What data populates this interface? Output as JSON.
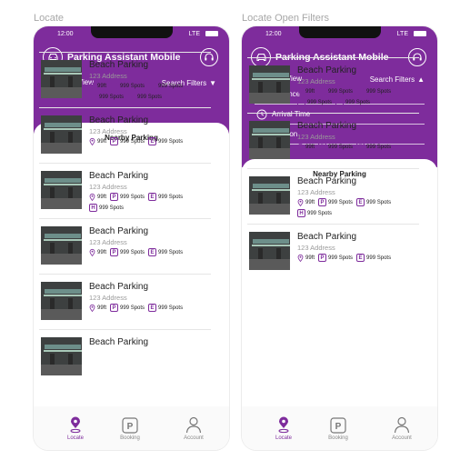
{
  "frames": [
    {
      "label": "Locate",
      "status": {
        "time": "12:00",
        "network": "LTE"
      },
      "app_title": "Parking Assistant Mobile",
      "map_view_label": "Map View",
      "search_filters_label": "Search Filters",
      "search_filters_arrow": "▼",
      "section_title": "Nearby Parking",
      "items": [
        {
          "name": "Beach Parking",
          "address": "123 Address",
          "distance": "99ft",
          "parking_spots": "999 Spots",
          "electric_spots": "999 Spots",
          "handicap_spots": "999 Spots",
          "reserved_spots": "999 Spots"
        },
        {
          "name": "Beach Parking",
          "address": "123 Address",
          "distance": "99ft",
          "parking_spots": "999 Spots",
          "electric_spots": "999 Spots"
        },
        {
          "name": "Beach Parking",
          "address": "123 Address",
          "distance": "99ft",
          "parking_spots": "999 Spots",
          "electric_spots": "999 Spots",
          "handicap_spots": "999 Spots"
        },
        {
          "name": "Beach Parking",
          "address": "123 Address",
          "distance": "99ft",
          "parking_spots": "999 Spots",
          "electric_spots": "999 Spots"
        },
        {
          "name": "Beach Parking",
          "address": "123 Address",
          "distance": "99ft",
          "parking_spots": "999 Spots",
          "electric_spots": "999 Spots"
        },
        {
          "name": "Beach Parking"
        }
      ],
      "tabs": [
        {
          "label": "Locate",
          "icon": "location-pin-icon",
          "active": true
        },
        {
          "label": "Booking",
          "icon": "parking-sign-icon",
          "active": false
        },
        {
          "label": "Account",
          "icon": "user-icon",
          "active": false
        }
      ]
    },
    {
      "label": "Locate Open Filters",
      "status": {
        "time": "12:00",
        "network": "LTE"
      },
      "app_title": "Parking Assistant Mobile",
      "map_view_label": "Map View",
      "search_filters_label": "Search Filters",
      "search_filters_arrow": "▲",
      "filters": [
        {
          "label": "Distance",
          "icon": "distance-icon"
        },
        {
          "label": "Arrival Time",
          "icon": "clock-icon"
        },
        {
          "label": "Location",
          "icon": "location-pin-icon"
        }
      ],
      "section_title": "Nearby Parking",
      "items": [
        {
          "name": "Beach Parking",
          "address": "123 Address",
          "distance": "99ft",
          "parking_spots": "999 Spots",
          "electric_spots": "999 Spots",
          "handicap_spots": "999 Spots",
          "reserved_spots": "999 Spots"
        },
        {
          "name": "Beach Parking",
          "address": "123 Address",
          "distance": "99ft",
          "parking_spots": "999 Spots",
          "electric_spots": "999 Spots"
        },
        {
          "name": "Beach Parking",
          "address": "123 Address",
          "distance": "99ft",
          "parking_spots": "999 Spots",
          "electric_spots": "999 Spots",
          "handicap_spots": "999 Spots"
        },
        {
          "name": "Beach Parking",
          "address": "123 Address",
          "distance": "99ft",
          "parking_spots": "999 Spots",
          "electric_spots": "999 Spots"
        }
      ],
      "tabs": [
        {
          "label": "Locate",
          "icon": "location-pin-icon",
          "active": true
        },
        {
          "label": "Booking",
          "icon": "parking-sign-icon",
          "active": false
        },
        {
          "label": "Account",
          "icon": "user-icon",
          "active": false
        }
      ]
    }
  ],
  "badge_letters": {
    "parking": "P",
    "electric": "E",
    "handicap": "H",
    "reserved": "R"
  },
  "colors": {
    "brand_purple": "#7e2c9c",
    "background": "#fafafa",
    "muted_text": "#9a9a9a"
  }
}
